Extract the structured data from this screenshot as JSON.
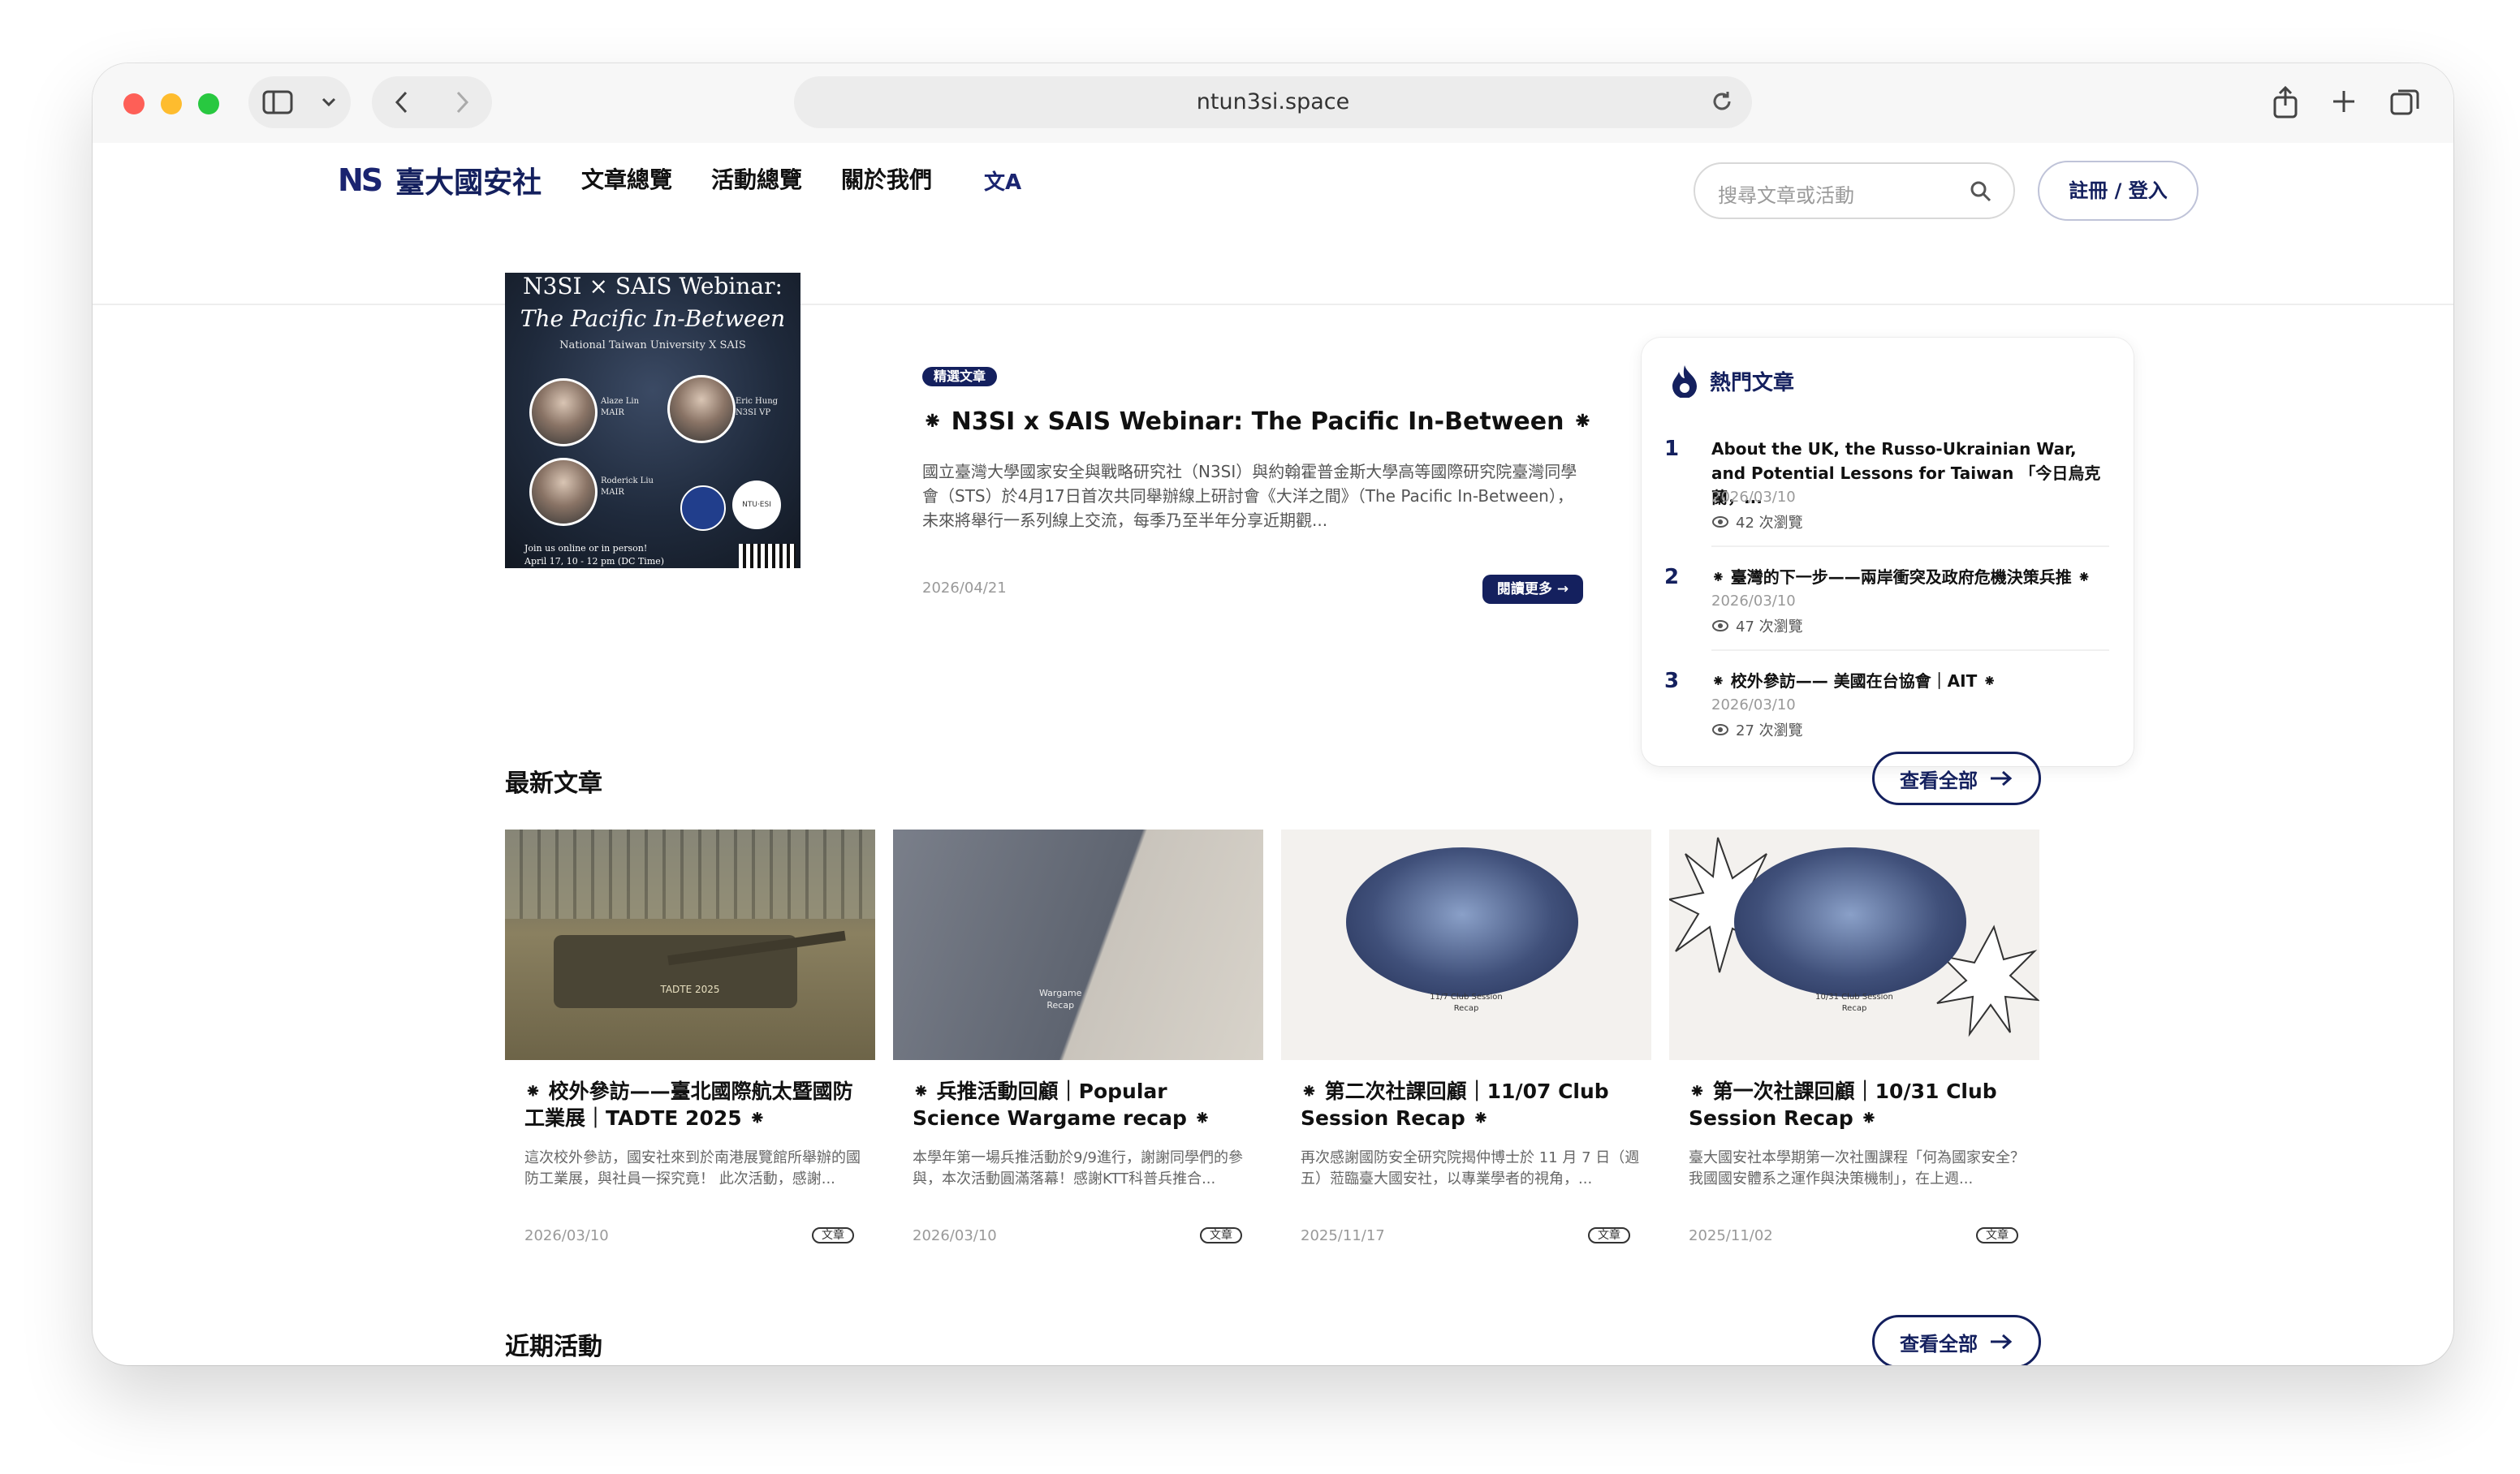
{
  "browser": {
    "url": "ntun3si.space"
  },
  "header": {
    "logo_mark": "NS",
    "logo_text": "臺大國安社",
    "nav": [
      "文章總覽",
      "活動總覽",
      "關於我們"
    ],
    "translate_icon": "文A",
    "search_placeholder": "搜尋文章或活動",
    "login_label": "註冊 / 登入"
  },
  "featured": {
    "image": {
      "line1": "N3SI × SAIS Webinar:",
      "line2": "The Pacific In-Between",
      "line3": "National Taiwan University X SAIS",
      "p1": "Alaze Lin",
      "p1_role": "MAIR",
      "p2": "Eric Hung",
      "p2_role": "N3SI VP",
      "p3": "Roderick Liu",
      "p3_role": "MAIR",
      "logo": "NTU·ESI",
      "footer": "Join us online or in person!",
      "footer2": "April 17, 10 - 12 pm (DC Time)"
    },
    "badge": "精選文章",
    "title": "⁕ N3SI x SAIS Webinar: The Pacific In-Between ⁕",
    "description": "國立臺灣大學國家安全與戰略研究社（N3SI）與約翰霍普金斯大學高等國際研究院臺灣同學會（STS）於4月17日首次共同舉辦線上研討會《大洋之間》（The Pacific In-Between），未來將舉行一系列線上交流，每季乃至半年分享近期觀...",
    "date": "2026/04/21",
    "read_more": "閱讀更多 →"
  },
  "hot": {
    "title": "熱門文章",
    "items": [
      {
        "rank": "1",
        "title": "About the UK, the Russo-Ukrainian War, and Potential Lessons for Taiwan 「今日烏克蘭，...",
        "date": "2026/03/10",
        "views": "42 次瀏覽"
      },
      {
        "rank": "2",
        "title": "⁕ 臺灣的下一步——兩岸衝突及政府危機決策兵推 ⁕",
        "date": "2026/03/10",
        "views": "47 次瀏覽"
      },
      {
        "rank": "3",
        "title": "⁕ 校外參訪—— 美國在台協會｜AIT ⁕",
        "date": "2026/03/10",
        "views": "27 次瀏覽"
      }
    ]
  },
  "latest": {
    "title": "最新文章",
    "view_all": "查看全部",
    "cards": [
      {
        "img_label": "TADTE 2025",
        "title": "⁕ 校外參訪——臺北國際航太暨國防工業展｜TADTE 2025 ⁕",
        "desc": "這次校外參訪，國安社來到於南港展覽館所舉辦的國防工業展，與社員一探究竟！ 此次活動，感謝...",
        "date": "2026/03/10",
        "tag": "文章"
      },
      {
        "img_label": "Wargame\nRecap",
        "title": "⁕ 兵推活動回顧｜Popular Science Wargame recap ⁕",
        "desc": "本學年第一場兵推活動於9/9進行，謝謝同學們的參與，本次活動圓滿落幕！感謝KTT科普兵推合...",
        "date": "2026/03/10",
        "tag": "文章"
      },
      {
        "img_label": "11/7 Club Session\nRecap",
        "title": "⁕ 第二次社課回顧｜11/07 Club Session Recap ⁕",
        "desc": "再次感謝國防安全研究院揭仲博士於 11 月 7 日（週五）蒞臨臺大國安社，以專業學者的視角，...",
        "date": "2025/11/17",
        "tag": "文章"
      },
      {
        "img_label": "10/31 Club Session\nRecap",
        "title": "⁕ 第一次社課回顧｜10/31 Club Session Recap ⁕",
        "desc": "臺大國安社本學期第一次社團課程「何為國家安全？我國國安體系之運作與決策機制」，在上週...",
        "date": "2025/11/02",
        "tag": "文章"
      }
    ]
  },
  "events": {
    "title": "近期活動",
    "view_all": "查看全部"
  },
  "colors": {
    "brand": "#14205e",
    "accent_red": "#fe5f57",
    "accent_yellow": "#febc2e",
    "accent_green": "#28c840"
  }
}
